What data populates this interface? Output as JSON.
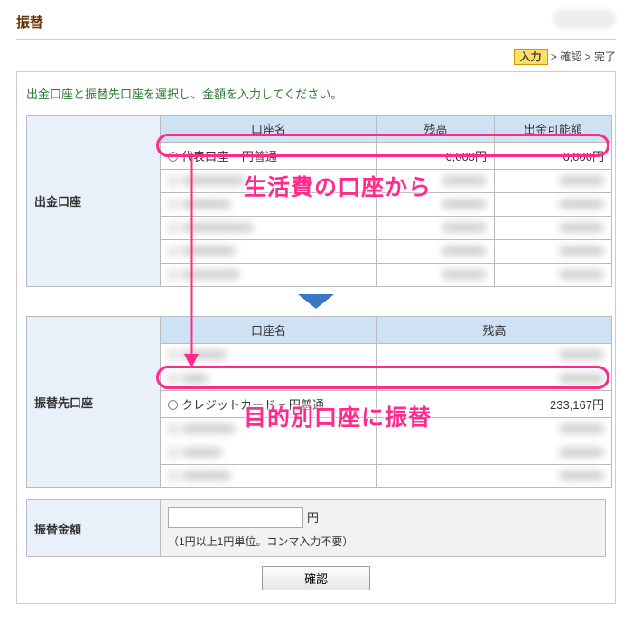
{
  "title": "振替",
  "steps": {
    "current": "入力",
    "next1": "確認",
    "next2": "完了"
  },
  "instruction": "出金口座と振替先口座を選択し、金額を入力してください。",
  "headers": {
    "account_name": "口座名",
    "balance": "残高",
    "available": "出金可能額"
  },
  "source": {
    "label": "出金口座",
    "rows": [
      {
        "name": "代表口座 − 円普通",
        "balance": "6,000円",
        "available": "6,000円",
        "highlighted": true
      }
    ]
  },
  "dest": {
    "label": "振替先口座",
    "rows": [
      {
        "name": "クレジットカード − 円普通",
        "balance": "233,167円",
        "highlighted": true
      }
    ]
  },
  "amount": {
    "label": "振替金額",
    "value": "",
    "unit": "円",
    "hint": "（1円以上1円単位。コンマ入力不要）"
  },
  "confirm_label": "確認",
  "annotations": {
    "from_text": "生活費の口座から",
    "to_text": "目的別口座に振替"
  }
}
